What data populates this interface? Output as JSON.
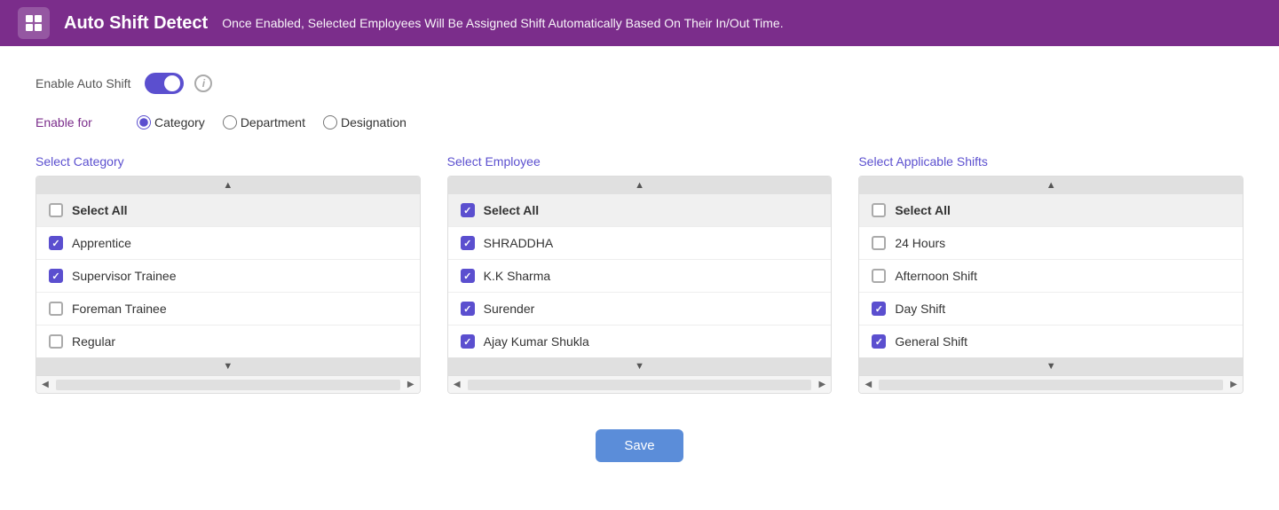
{
  "header": {
    "icon": "⊞",
    "title": "Auto Shift Detect",
    "description": "Once Enabled, Selected Employees Will Be Assigned Shift Automatically Based On Their In/Out Time."
  },
  "enable_auto_shift": {
    "label": "Enable Auto Shift",
    "toggled": true
  },
  "enable_for": {
    "label": "Enable for",
    "options": [
      "Category",
      "Department",
      "Designation"
    ],
    "selected": "Category"
  },
  "category_list": {
    "title": "Select Category",
    "select_all_label": "Select All",
    "select_all_checked": false,
    "items": [
      {
        "label": "Apprentice",
        "checked": true
      },
      {
        "label": "Supervisor Trainee",
        "checked": true
      },
      {
        "label": "Foreman Trainee",
        "checked": false
      },
      {
        "label": "Regular",
        "checked": false
      }
    ]
  },
  "employee_list": {
    "title": "Select Employee",
    "select_all_label": "Select All",
    "select_all_checked": true,
    "items": [
      {
        "label": "SHRADDHA",
        "checked": true
      },
      {
        "label": "K.K Sharma",
        "checked": true
      },
      {
        "label": "Surender",
        "checked": true
      },
      {
        "label": "Ajay Kumar Shukla",
        "checked": true
      }
    ]
  },
  "shifts_list": {
    "title": "Select Applicable Shifts",
    "select_all_label": "Select All",
    "select_all_checked": false,
    "items": [
      {
        "label": "24 Hours",
        "checked": false
      },
      {
        "label": "Afternoon Shift",
        "checked": false
      },
      {
        "label": "Day Shift",
        "checked": true
      },
      {
        "label": "General Shift",
        "checked": true
      }
    ]
  },
  "save_button": "Save"
}
